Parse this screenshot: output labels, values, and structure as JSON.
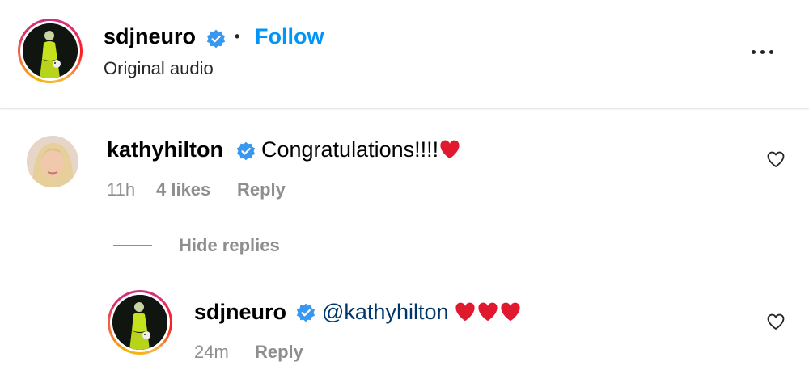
{
  "post_header": {
    "username": "sdjneuro",
    "separator": "•",
    "follow_label": "Follow",
    "subtitle": "Original audio"
  },
  "comment": {
    "username": "kathyhilton",
    "text": "Congratulations!!!!",
    "time": "11h",
    "likes": "4 likes",
    "reply_label": "Reply",
    "hide_replies_label": "Hide replies"
  },
  "reply": {
    "username": "sdjneuro",
    "mention": "@kathyhilton",
    "time": "24m",
    "reply_label": "Reply"
  },
  "colors": {
    "follow_blue": "#0095f6",
    "verified_blue": "#3897f0",
    "mention_dark_blue": "#00376b",
    "muted_gray": "#8e8e8e",
    "heart_red": "#e0192e"
  }
}
